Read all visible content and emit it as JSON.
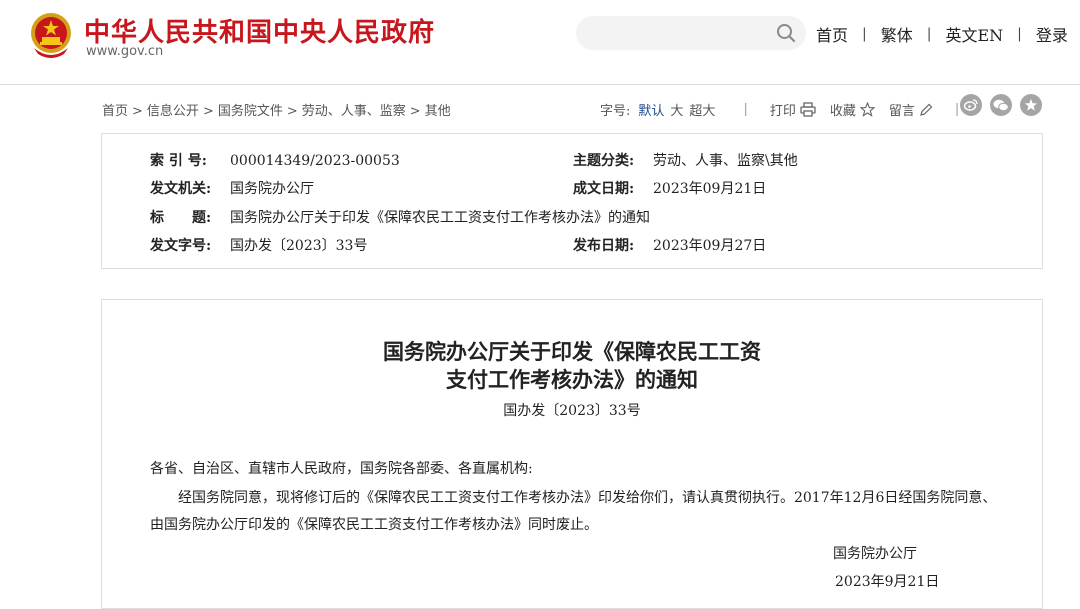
{
  "header": {
    "site_title": "中华人民共和国中央人民政府",
    "site_url": "www.gov.cn",
    "search_placeholder": "",
    "nav": [
      "首页",
      "繁体",
      "英文EN",
      "登录"
    ]
  },
  "breadcrumb": [
    "首页",
    "信息公开",
    "国务院文件",
    "劳动、人事、监察",
    "其他"
  ],
  "tools": {
    "font_size_label": "字号:",
    "font_sizes": [
      "默认",
      "大",
      "超大"
    ],
    "print": "打印",
    "favorite": "收藏",
    "comment": "留言"
  },
  "meta": {
    "index_no_label": "索 引 号:",
    "index_no": "000014349/2023-00053",
    "topic_label": "主题分类:",
    "topic": "劳动、人事、监察\\其他",
    "issuer_label": "发文机关:",
    "issuer": "国务院办公厅",
    "date_written_label": "成文日期:",
    "date_written": "2023年09月21日",
    "title_label": "标　　题:",
    "title": "国务院办公厅关于印发《保障农民工工资支付工作考核办法》的通知",
    "doc_no_label": "发文字号:",
    "doc_no": "国办发〔2023〕33号",
    "publish_date_label": "发布日期:",
    "publish_date": "2023年09月27日"
  },
  "article": {
    "title_line1": "国务院办公厅关于印发《保障农民工工资",
    "title_line2": "支付工作考核办法》的通知",
    "doc_no": "国办发〔2023〕33号",
    "salutation": "各省、自治区、直辖市人民政府，国务院各部委、各直属机构:",
    "body_line1": "经国务院同意，现将修订后的《保障农民工工资支付工作考核办法》印发给你们，请认真贯彻执行。2017年12月6日经国务院同意、",
    "body_line2": "由国务院办公厅印发的《保障农民工工资支付工作考核办法》同时废止。",
    "signature": "国务院办公厅",
    "sign_date": "2023年9月21日"
  },
  "colors": {
    "brand_red": "#c8161d",
    "active_blue": "#1e4b8e",
    "share_gray": "#a5a5a5"
  }
}
